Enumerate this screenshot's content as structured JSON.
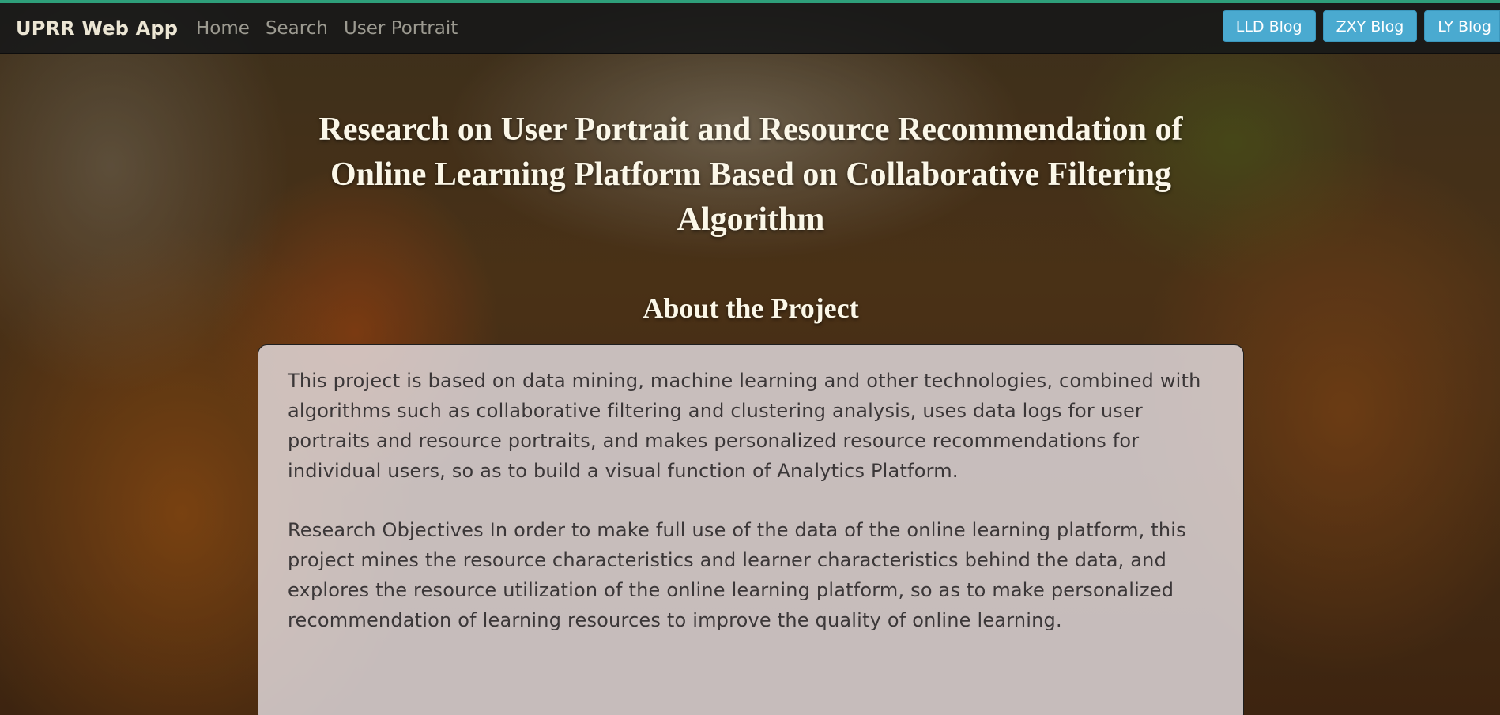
{
  "navbar": {
    "brand": "UPRR Web App",
    "links": [
      "Home",
      "Search",
      "User Portrait"
    ],
    "blog_buttons": [
      "LLD Blog",
      "ZXY Blog",
      "LY Blog"
    ]
  },
  "hero": {
    "title": "Research on User Portrait and Resource Recommendation of Online Learning Platform Based on Collaborative Filtering Algorithm",
    "section_heading": "About the Project"
  },
  "about": {
    "paragraph_1": "This project is based on data mining, machine learning and other technologies, combined with algorithms such as collaborative filtering and clustering analysis, uses data logs for user portraits and resource portraits, and makes personalized resource recommendations for individual users, so as to build a visual function of Analytics Platform.",
    "paragraph_2": "Research Objectives In order to make full use of the data of the online learning platform, this project mines the resource characteristics and learner characteristics behind the data, and explores the resource utilization of the online learning platform, so as to make personalized recommendation of learning resources to improve the quality of online learning."
  },
  "colors": {
    "accent_top": "#2e9f7a",
    "blog_button": "#4aaad0",
    "navbar_bg": "#141618"
  }
}
